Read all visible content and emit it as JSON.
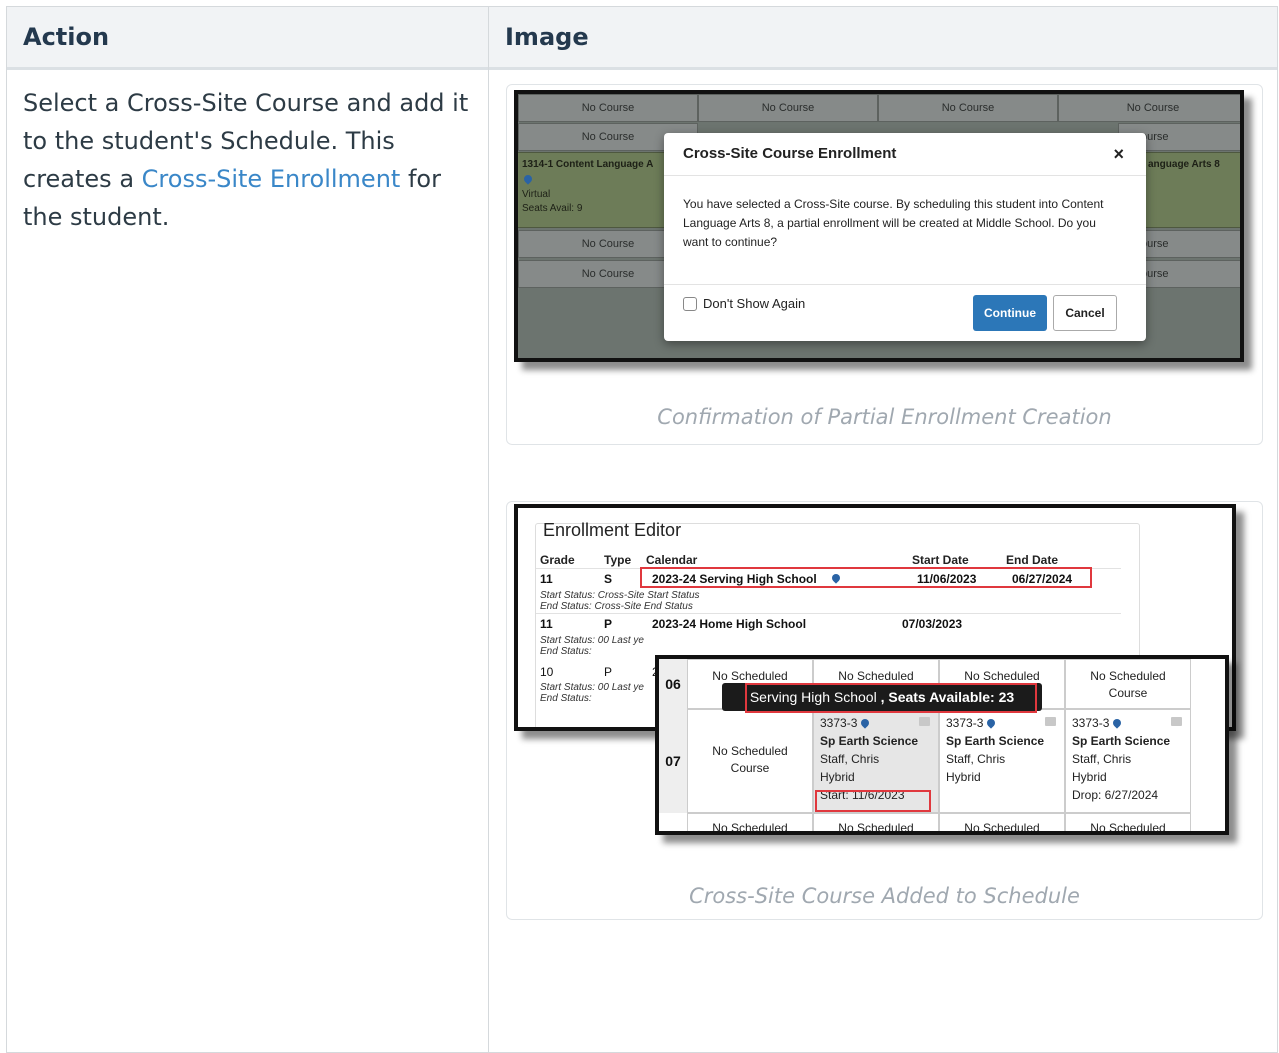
{
  "table": {
    "headers": {
      "action": "Action",
      "image": "Image"
    }
  },
  "action": {
    "text_1": "Select a Cross-Site Course and add it to the student's Schedule. This creates a ",
    "link": "Cross-Site Enrollment",
    "text_2": " for the student."
  },
  "figure_1": {
    "caption": "Confirmation of Partial Enrollment Creation",
    "grid": {
      "no_course": "No Course",
      "no_course_partial": "ourse",
      "course_left": "1314-1 Content Language A",
      "course_right": "anguage Arts 8",
      "course_mode": "Virtual",
      "seats": "Seats Avail: 9"
    },
    "modal": {
      "title": "Cross-Site Course Enrollment",
      "close": "×",
      "body": "You have selected a Cross-Site course. By scheduling this student into Content Language Arts 8, a partial enrollment will be created at Middle School. Do you want to continue?",
      "checkbox_label": "Don't Show Again",
      "continue": "Continue",
      "cancel": "Cancel"
    }
  },
  "figure_2": {
    "caption": "Cross-Site Course Added to Schedule",
    "editor": {
      "title": "Enrollment Editor",
      "headers": {
        "grade": "Grade",
        "type": "Type",
        "calendar": "Calendar",
        "start": "Start Date",
        "end": "End Date"
      },
      "row1": {
        "grade": "11",
        "type": "S",
        "calendar": "2023-24 Serving High School",
        "start": "11/06/2023",
        "end": "06/27/2024",
        "start_status": "Start Status: Cross-Site Start Status",
        "end_status": "End Status:  Cross-Site End Status"
      },
      "row2": {
        "grade": "11",
        "type": "P",
        "calendar": "2023-24 Home High School",
        "start": "07/03/2023",
        "start_status": "Start Status: 00 Last ye",
        "end_status": "End Status:"
      },
      "row3": {
        "grade": "10",
        "type": "P",
        "calendar": "2",
        "start_status": "Start Status: 00 Last ye",
        "end_status": "End Status:"
      }
    },
    "schedule": {
      "periods": [
        "06",
        "07"
      ],
      "no_scheduled": "No Scheduled",
      "no_scheduled_course": "No Scheduled Course",
      "tooltip_school": "Serving High School",
      "tooltip_seats": " , Seats Available: 23",
      "section": "3373-3",
      "course": "Sp Earth Science",
      "teacher": "Staff, Chris",
      "mode": "Hybrid",
      "start": "Start: 11/6/2023",
      "drop": "Drop: 6/27/2024"
    }
  }
}
